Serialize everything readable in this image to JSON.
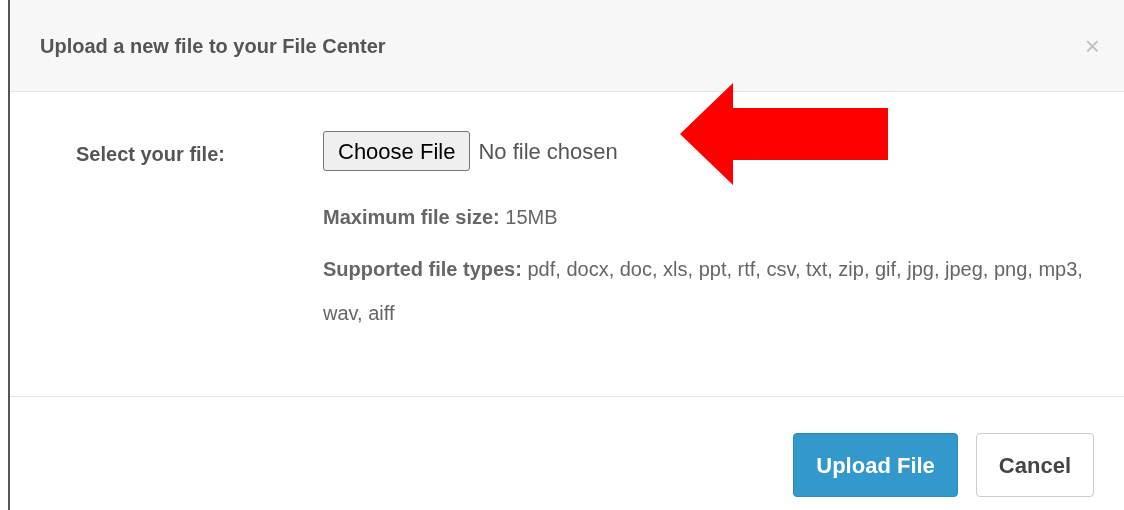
{
  "dialog": {
    "title": "Upload a new file to your File Center",
    "close": "×"
  },
  "field": {
    "label": "Select your file:",
    "button": "Choose File",
    "status": "No file chosen"
  },
  "notes": [
    "**Maximum file size:** 15MB",
    "**Supported file types:** pdf, docx, doc, xls, ppt, rtf, csv, txt, zip, gif, jpg, jpeg, png, mp3, wav, aiff"
  ],
  "buttons": [
    {
      "label": "Upload File",
      "kind": "primary"
    },
    {
      "label": "Cancel",
      "kind": "secondary"
    }
  ]
}
